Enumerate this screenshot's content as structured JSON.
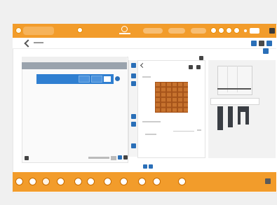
{
  "topbar": {
    "badge1": "",
    "badge2": "",
    "search_placeholder": ""
  },
  "left_panel": {
    "header": "",
    "footer_label": ""
  },
  "middle": {
    "field1": "",
    "field2": ""
  },
  "colors": {
    "accent": "#f29c2b",
    "selection": "#2f7fd1",
    "panel": "#b8641f",
    "icon_blue": "#2a6fb8"
  },
  "icons": {
    "top_circles": [
      "circle-icon",
      "circle-icon",
      "circle-icon",
      "circle-icon"
    ],
    "toolbar": [
      "tool-1",
      "tool-2",
      "tool-3",
      "tool-4",
      "tool-5",
      "tool-6",
      "tool-7",
      "tool-8",
      "tool-9",
      "tool-10",
      "tool-11"
    ]
  }
}
